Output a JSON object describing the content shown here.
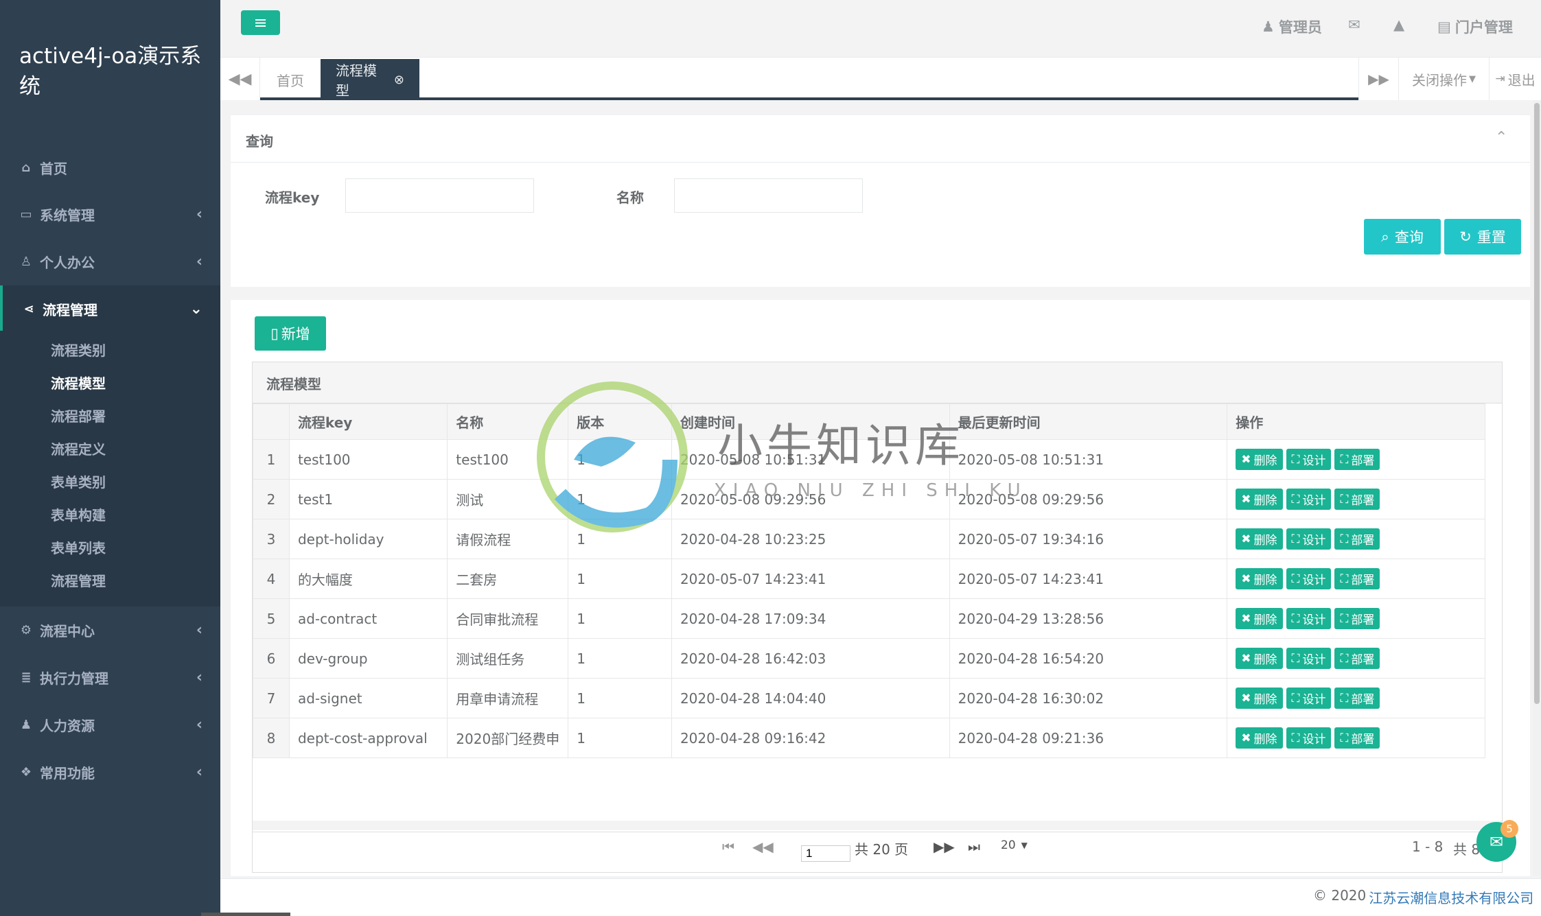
{
  "app": {
    "title": "active4j-oa演示系统"
  },
  "sidebar": {
    "items": [
      {
        "icon": "home-icon",
        "glyph": "⌂",
        "label": "首页"
      },
      {
        "icon": "desktop-icon",
        "glyph": "▭",
        "label": "系统管理"
      },
      {
        "icon": "user-icon",
        "glyph": "♙",
        "label": "个人办公"
      },
      {
        "icon": "share-icon",
        "glyph": "⋖",
        "label": "流程管理"
      },
      {
        "icon": "gear-icon",
        "glyph": "⚙",
        "label": "流程中心"
      },
      {
        "icon": "list-icon",
        "glyph": "≣",
        "label": "执行力管理"
      },
      {
        "icon": "user-plus-icon",
        "glyph": "♟",
        "label": "人力资源"
      },
      {
        "icon": "cubes-icon",
        "glyph": "❖",
        "label": "常用功能"
      }
    ],
    "sub_items": [
      "流程类别",
      "流程模型",
      "流程部署",
      "流程定义",
      "表单类别",
      "表单构建",
      "表单列表",
      "流程管理"
    ],
    "active_sub": "流程模型"
  },
  "topbar": {
    "admin": "管理员",
    "portal": "门户管理",
    "icons": [
      "user-icon",
      "envelope-icon",
      "bell-icon",
      "portal-icon"
    ]
  },
  "tabs": {
    "home": "首页",
    "current": "流程模型",
    "close_ops": "关闭操作",
    "logout": "退出"
  },
  "query": {
    "title": "查询",
    "key_label": "流程key",
    "name_label": "名称",
    "key_value": "",
    "name_value": "",
    "search_btn": "查询",
    "reset_btn": "重置"
  },
  "grid": {
    "add_btn": "新增",
    "caption": "流程模型",
    "columns": [
      "流程key",
      "名称",
      "版本",
      "创建时间",
      "最后更新时间",
      "操作"
    ],
    "op_labels": {
      "delete": "删除",
      "design": "设计",
      "deploy": "部署"
    },
    "rows": [
      {
        "n": "1",
        "key": "test100",
        "name": "test100",
        "ver": "1",
        "created": "2020-05-08 10:51:31",
        "updated": "2020-05-08 10:51:31"
      },
      {
        "n": "2",
        "key": "test1",
        "name": "测试",
        "ver": "1",
        "created": "2020-05-08 09:29:56",
        "updated": "2020-05-08 09:29:56"
      },
      {
        "n": "3",
        "key": "dept-holiday",
        "name": "请假流程",
        "ver": "1",
        "created": "2020-04-28 10:23:25",
        "updated": "2020-05-07 19:34:16"
      },
      {
        "n": "4",
        "key": "的大幅度",
        "name": "二套房",
        "ver": "1",
        "created": "2020-05-07 14:23:41",
        "updated": "2020-05-07 14:23:41"
      },
      {
        "n": "5",
        "key": "ad-contract",
        "name": "合同审批流程",
        "ver": "1",
        "created": "2020-04-28 17:09:34",
        "updated": "2020-04-29 13:28:56"
      },
      {
        "n": "6",
        "key": "dev-group",
        "name": "测试组任务",
        "ver": "1",
        "created": "2020-04-28 16:42:03",
        "updated": "2020-04-28 16:54:20"
      },
      {
        "n": "7",
        "key": "ad-signet",
        "name": "用章申请流程",
        "ver": "1",
        "created": "2020-04-28 14:04:40",
        "updated": "2020-04-28 16:30:02"
      },
      {
        "n": "8",
        "key": "dept-cost-approval",
        "name": "2020部门经费申",
        "ver": "1",
        "created": "2020-04-28 09:16:42",
        "updated": "2020-04-28 09:21:36"
      }
    ]
  },
  "pager": {
    "page_input": "1",
    "total_pages_text": "共 20 页",
    "page_size": "20",
    "range": "1 - 8",
    "total_text": "共 8"
  },
  "chat": {
    "badge": "5"
  },
  "watermark": {
    "cn": "小牛知识库",
    "pinyin": "XIAO NIU ZHI SHI KU"
  },
  "footer": {
    "copyright": "© 2020 ",
    "company": "江苏云潮信息技术有限公司"
  },
  "colors": {
    "sidebar": "#2f4050",
    "accent": "#1ab394",
    "cyan": "#23c6c8"
  }
}
